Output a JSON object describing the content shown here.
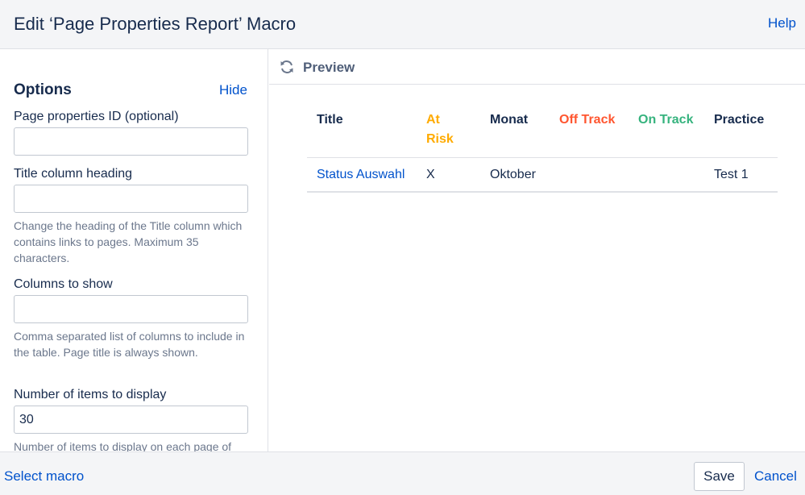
{
  "dialog": {
    "title": "Edit ‘Page Properties Report’ Macro",
    "help_label": "Help"
  },
  "options": {
    "heading": "Options",
    "hide_label": "Hide",
    "page_properties_id": {
      "label": "Page properties ID (optional)",
      "value": ""
    },
    "title_column_heading": {
      "label": "Title column heading",
      "value": "",
      "hint": "Change the heading of the Title column which contains links to pages. Maximum 35 characters."
    },
    "columns_to_show": {
      "label": "Columns to show",
      "value": "",
      "hint": "Comma separated list of columns to include in the table. Page title is always shown."
    },
    "items_to_display": {
      "label": "Number of items to display",
      "value": "30",
      "hint": "Number of items to display on each page of"
    }
  },
  "preview": {
    "label": "Preview",
    "icon": "refresh-icon",
    "columns": [
      {
        "label": "Title",
        "color": "#172b4d"
      },
      {
        "label": "At Risk",
        "color": "#ffab00"
      },
      {
        "label": "Monat",
        "color": "#172b4d"
      },
      {
        "label": "Off Track",
        "color": "#ff5630"
      },
      {
        "label": "On Track",
        "color": "#36b37e"
      },
      {
        "label": "Practice",
        "color": "#172b4d"
      }
    ],
    "rows": [
      {
        "title": "Status Auswahl",
        "at_risk": "X",
        "monat": "Oktober",
        "off_track": "",
        "on_track": "",
        "practice": "Test 1"
      }
    ]
  },
  "footer": {
    "select_macro_label": "Select macro",
    "save_label": "Save",
    "cancel_label": "Cancel"
  },
  "colors": {
    "link": "#0052cc",
    "text": "#172b4d",
    "muted": "#6b778c",
    "panel_bg": "#f4f5f7",
    "border": "#dfe1e6"
  }
}
